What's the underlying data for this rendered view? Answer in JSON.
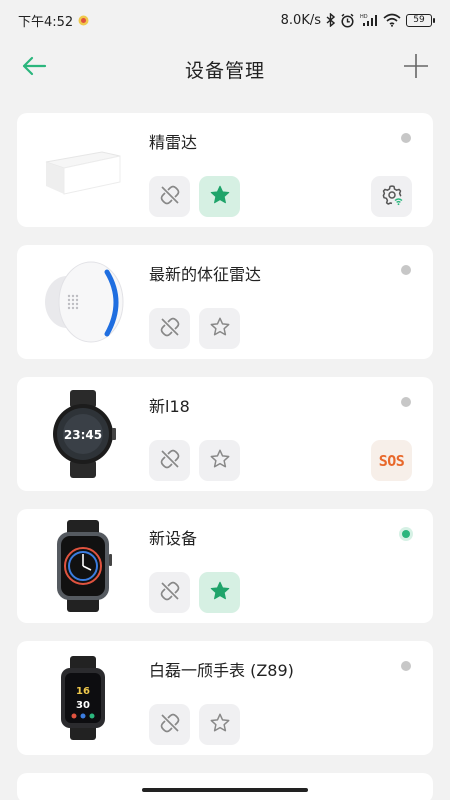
{
  "status_bar": {
    "time": "下午4:52",
    "net_speed": "8.0K/s",
    "battery": "59"
  },
  "header": {
    "title": "设备管理"
  },
  "devices": [
    {
      "name": "精雷达",
      "online": false,
      "favorite": true,
      "extra_icon": "wifi-settings-icon"
    },
    {
      "name": "最新的体征雷达",
      "online": false,
      "favorite": false,
      "extra_icon": ""
    },
    {
      "name": "新l18",
      "online": false,
      "favorite": false,
      "extra_icon": "sos-icon",
      "extra_label": "SOS"
    },
    {
      "name": "新设备",
      "online": true,
      "favorite": true,
      "extra_icon": ""
    },
    {
      "name": "白磊一颀手表 (Z89)",
      "online": false,
      "favorite": false,
      "extra_icon": ""
    }
  ],
  "colors": {
    "accent": "#2bb67d",
    "background": "#f2f2f2",
    "card": "#ffffff",
    "sos": "#e8682b"
  }
}
